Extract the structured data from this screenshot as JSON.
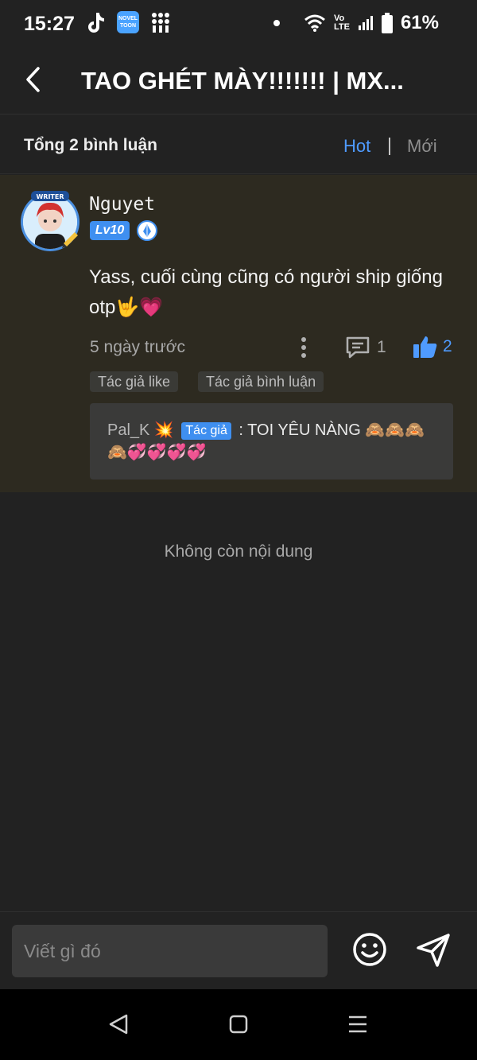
{
  "status_bar": {
    "time": "15:27",
    "app_badge_novel": "NOVEL TOON",
    "network": "Vo LTE",
    "battery": "61%"
  },
  "header": {
    "title": "TAO GHÉT MÀY!!!!!!! | MX..."
  },
  "sort": {
    "total": "Tổng 2 bình luận",
    "hot": "Hot",
    "separator": "|",
    "new": "Mới"
  },
  "comment": {
    "username": "Nguyet",
    "avatar_badge": "WRITER",
    "level": "Lv10",
    "text": "Yass, cuối cùng cũng có người ship giống otp🤟💗",
    "time": "5 ngày trước",
    "reply_count": "1",
    "like_count": "2",
    "tags": [
      "Tác giả like",
      "Tác giả bình luận"
    ],
    "reply": {
      "author": "Pal_K 💥",
      "author_tag": "Tác giả",
      "text": ": TOI YÊU NÀNG 🙈🙈🙈🙈💞💞💞💞"
    }
  },
  "end_message": "Không còn nội dung",
  "input": {
    "placeholder": "Viết gì đó"
  },
  "colors": {
    "accent": "#4f9bff",
    "background": "#222222",
    "card": "#2d2a20"
  }
}
